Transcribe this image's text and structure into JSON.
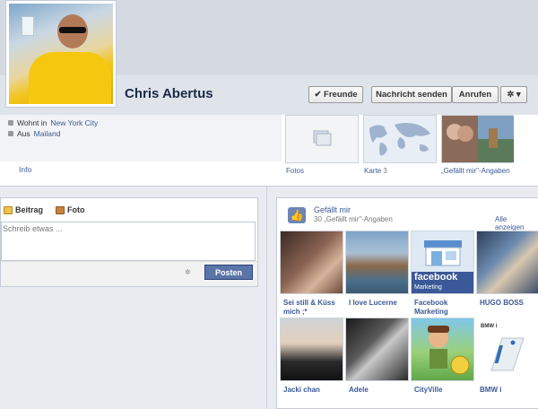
{
  "profile": {
    "name": "Chris Abertus",
    "buttons": {
      "friends": "✔ Freunde",
      "message": "Nachricht senden",
      "call": "Anrufen",
      "settings": "✲ ▾"
    }
  },
  "info": {
    "lives_in_prefix": "Wohnt in",
    "lives_in_city": "New York City",
    "from_prefix": "Aus",
    "from_city": "Mailand",
    "label": "Info"
  },
  "tiles": [
    {
      "label": "Fotos"
    },
    {
      "label": "Karte",
      "count": "3"
    },
    {
      "label": "„Gefällt mir\"-Angaben"
    }
  ],
  "composer": {
    "tab_post": "Beitrag",
    "tab_photo": "Foto",
    "placeholder": "Schreib etwas ...",
    "post_button": "Posten"
  },
  "likes": {
    "title": "Gefällt mir",
    "count_text": "30 „Gefällt mir\"-Angaben",
    "show_all": "Alle anzeigen",
    "items": [
      {
        "caption": "Sei still & Küss mich ;*"
      },
      {
        "caption": "I love Lucerne"
      },
      {
        "caption": "Facebook Marketing"
      },
      {
        "caption": "HUGO BOSS"
      },
      {
        "caption": "Jacki chan"
      },
      {
        "caption": "Adele"
      },
      {
        "caption": "CityVille"
      },
      {
        "caption": "BMW i"
      }
    ],
    "tile_texts": {
      "facebook_logo": "facebook",
      "facebook_sub": "Marketing",
      "bmw_text": "BMW i"
    }
  },
  "colors": {
    "link": "#3b5998",
    "button_primary": "#5b74a8",
    "page_bg": "#e9ebf0"
  }
}
